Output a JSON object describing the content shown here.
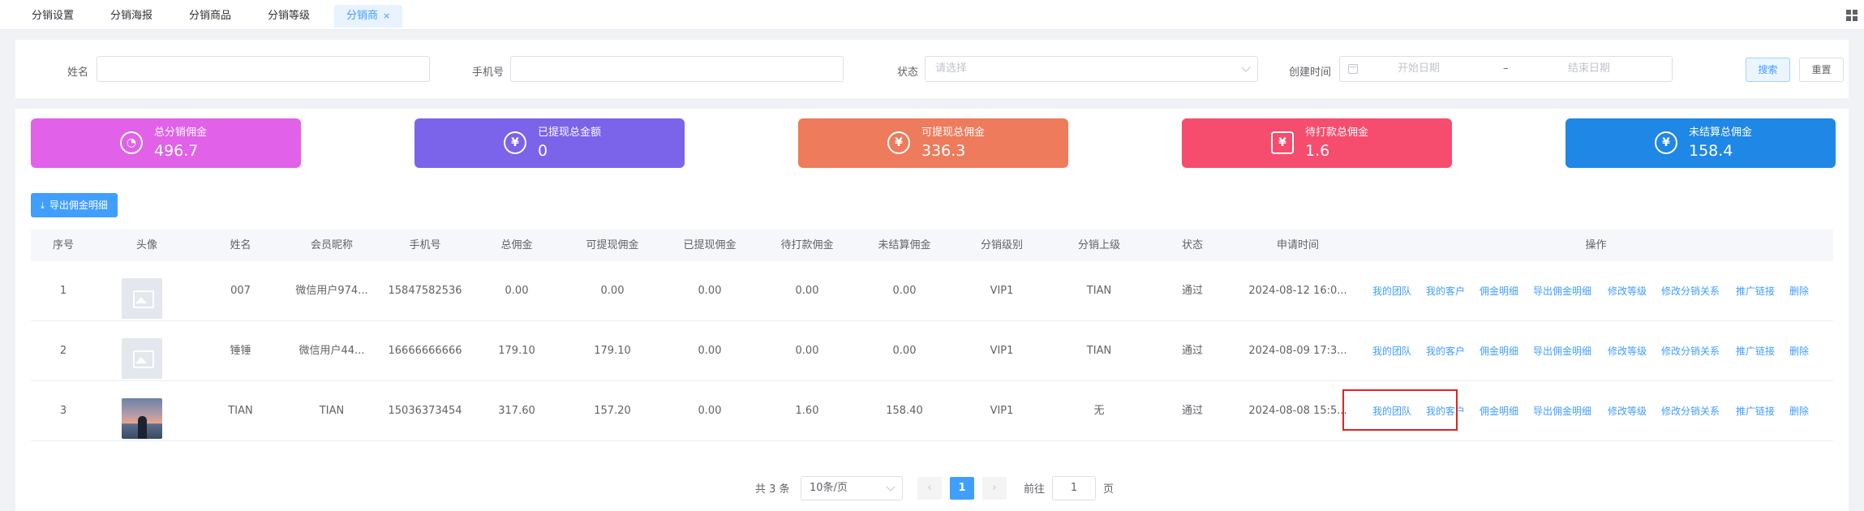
{
  "tabs": [
    {
      "label": "分销设置"
    },
    {
      "label": "分销海报"
    },
    {
      "label": "分销商品"
    },
    {
      "label": "分销等级"
    },
    {
      "label": "分销商",
      "close": "×"
    }
  ],
  "search": {
    "name_label": "姓名",
    "name_value": "",
    "phone_label": "手机号",
    "phone_value": "",
    "status_label": "状态",
    "status_placeholder": "请选择",
    "created_label": "创建时间",
    "start_placeholder": "开始日期",
    "range_sep": "–",
    "end_placeholder": "结束日期",
    "search_button": "搜索",
    "reset_button": "重置"
  },
  "stats": [
    {
      "title": "总分销佣金",
      "value": "496.7",
      "color": "#e161e8",
      "icon": "pie-chart-icon",
      "glyph": "◔"
    },
    {
      "title": "已提现总金额",
      "value": "0",
      "color": "#7b63ea",
      "icon": "yen-icon",
      "glyph": "¥"
    },
    {
      "title": "可提现总佣金",
      "value": "336.3",
      "color": "#ed7b5c",
      "icon": "yen-icon",
      "glyph": "¥"
    },
    {
      "title": "待打款总佣金",
      "value": "1.6",
      "color": "#f64c6e",
      "icon": "payment-clock-icon",
      "glyph": "¥"
    },
    {
      "title": "未结算总佣金",
      "value": "158.4",
      "color": "#1f87e5",
      "icon": "yen-icon",
      "glyph": "¥"
    }
  ],
  "export_button": "导出佣金明细",
  "table": {
    "headers": [
      "序号",
      "头像",
      "姓名",
      "会员昵称",
      "手机号",
      "总佣金",
      "可提现佣金",
      "已提现佣金",
      "待打款佣金",
      "未结算佣金",
      "分销级别",
      "分销上级",
      "状态",
      "申请时间",
      "操作"
    ],
    "rows": [
      {
        "index": "1",
        "avatar": "placeholder",
        "name": "007",
        "nickname": "微信用户974...",
        "phone": "15847582536",
        "total": "0.00",
        "withdrawable": "0.00",
        "withdrawn": "0.00",
        "pending": "0.00",
        "unsettled": "0.00",
        "level": "VIP1",
        "superior": "TIAN",
        "status": "通过",
        "applied": "2024-08-12 16:0..."
      },
      {
        "index": "2",
        "avatar": "placeholder",
        "name": "锤锤",
        "nickname": "微信用户44...",
        "phone": "16666666666",
        "total": "179.10",
        "withdrawable": "179.10",
        "withdrawn": "0.00",
        "pending": "0.00",
        "unsettled": "0.00",
        "level": "VIP1",
        "superior": "TIAN",
        "status": "通过",
        "applied": "2024-08-09 17:3..."
      },
      {
        "index": "3",
        "avatar": "photo",
        "name": "TIAN",
        "nickname": "TIAN",
        "phone": "15036373454",
        "total": "317.60",
        "withdrawable": "157.20",
        "withdrawn": "0.00",
        "pending": "1.60",
        "unsettled": "158.40",
        "level": "VIP1",
        "superior": "无",
        "status": "通过",
        "applied": "2024-08-08 15:5..."
      }
    ],
    "actions": [
      "我的团队",
      "我的客户",
      "佣金明细",
      "导出佣金明细",
      "修改等级",
      "修改分销关系",
      "推广链接",
      "删除"
    ]
  },
  "pagination": {
    "total_text": "共 3 条",
    "page_size": "10条/页",
    "prev": "‹",
    "current": "1",
    "next": "›",
    "goto_label": "前往",
    "goto_value": "1",
    "page_unit": "页"
  }
}
